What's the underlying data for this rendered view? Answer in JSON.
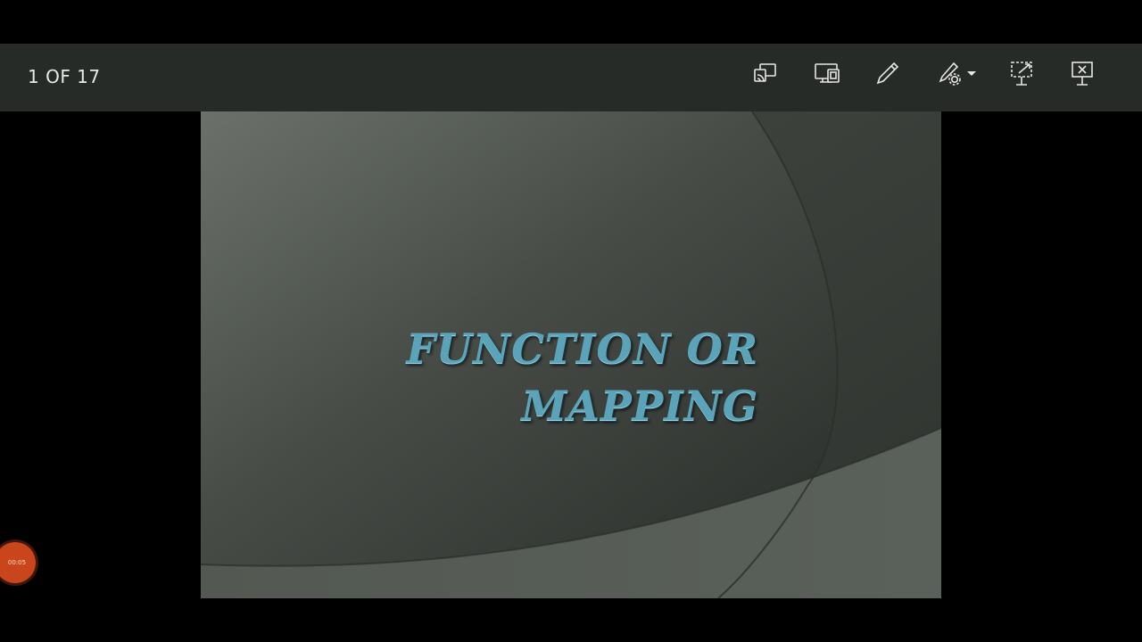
{
  "toolbar": {
    "slide_counter": "1 OF 17",
    "tools": [
      {
        "icon": "cast-icon"
      },
      {
        "icon": "presenter-view-icon"
      },
      {
        "icon": "pen-icon"
      },
      {
        "icon": "pen-settings-icon"
      },
      {
        "icon": "laser-pointer-icon"
      },
      {
        "icon": "end-slideshow-icon"
      }
    ]
  },
  "slide": {
    "title_line1": "FUNCTION OR",
    "title_line2": "MAPPING",
    "title_color": "#5aa3b8"
  },
  "recorder": {
    "timer": "00:05",
    "color": "#c9451c"
  }
}
